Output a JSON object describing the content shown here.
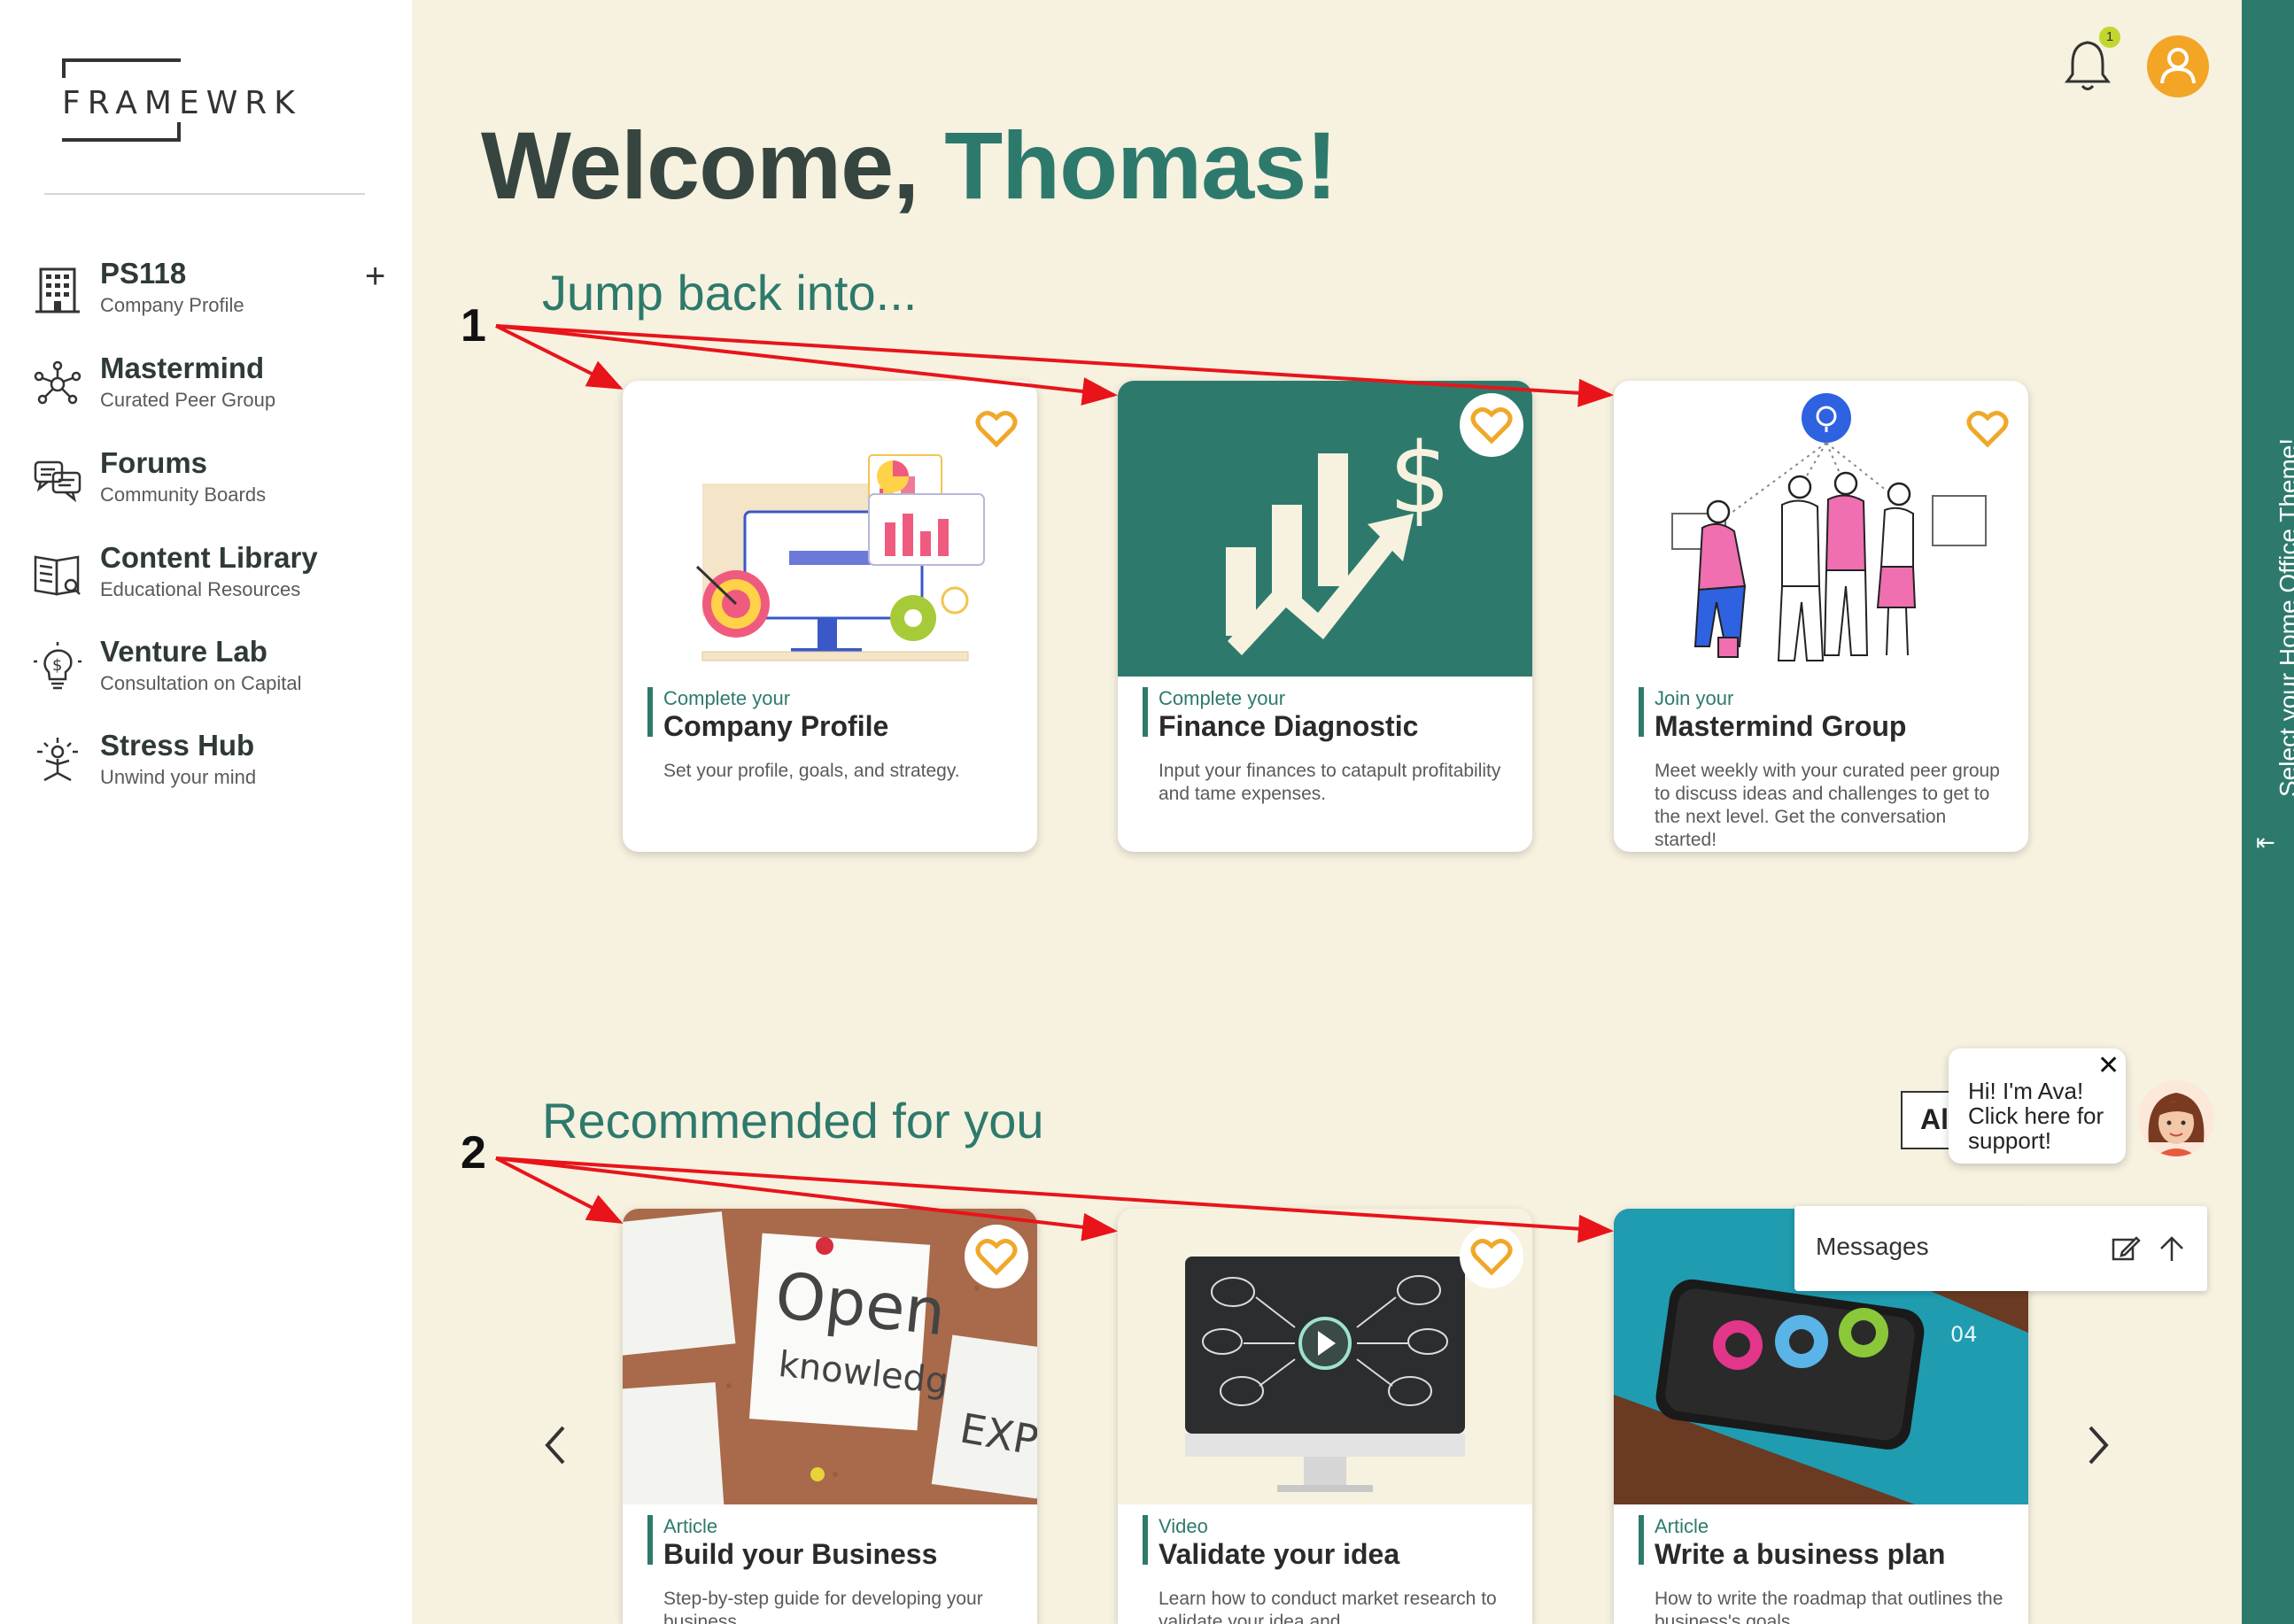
{
  "sidebar": {
    "logo": "FRAMEWRK",
    "items": [
      {
        "title": "PS118",
        "subtitle": "Company Profile",
        "icon": "building-icon",
        "action": "+"
      },
      {
        "title": "Mastermind",
        "subtitle": "Curated Peer Group",
        "icon": "network-icon"
      },
      {
        "title": "Forums",
        "subtitle": "Community Boards",
        "icon": "chat-bubbles-icon"
      },
      {
        "title": "Content Library",
        "subtitle": "Educational Resources",
        "icon": "book-icon"
      },
      {
        "title": "Venture Lab",
        "subtitle": "Consultation on Capital",
        "icon": "lightbulb-dollar-icon"
      },
      {
        "title": "Stress Hub",
        "subtitle": "Unwind your mind",
        "icon": "relax-person-icon"
      }
    ]
  },
  "header": {
    "notification_count": "1",
    "welcome_prefix": "Welcome, ",
    "welcome_name": "Thomas!"
  },
  "annotations": {
    "marker_1": "1",
    "marker_2": "2"
  },
  "jump_back": {
    "title": "Jump back into...",
    "cards": [
      {
        "kicker": "Complete your",
        "title": "Company Profile",
        "desc": "Set your profile, goals, and strategy."
      },
      {
        "kicker": "Complete your",
        "title": "Finance Diagnostic",
        "desc": "Input your finances to catapult profitability and tame expenses."
      },
      {
        "kicker": "Join your",
        "title": "Mastermind Group",
        "desc": "Meet weekly with your curated peer group to discuss ideas and challenges to get to the next level. Get the conversation started!"
      }
    ]
  },
  "recommended": {
    "title": "Recommended for you",
    "filter_label": "All",
    "cards": [
      {
        "kicker": "Article",
        "title": "Build your Business",
        "desc": "Step-by-step guide for developing your business"
      },
      {
        "kicker": "Video",
        "title": "Validate your idea",
        "desc": "Learn how to conduct market research to validate your idea and"
      },
      {
        "kicker": "Article",
        "title": "Write a business plan",
        "desc": "How to write the roadmap that outlines the business's goals"
      }
    ]
  },
  "theme_panel": {
    "label": "Select your Home Office Theme!",
    "toggle": "⇤"
  },
  "ava": {
    "text": "Hi! I'm Ava! Click here for support!",
    "close": "✕"
  },
  "messages": {
    "label": "Messages"
  },
  "colors": {
    "brand_green": "#2d7a6c",
    "background": "#f7f1e0",
    "heart": "#f0a82a",
    "avatar": "#f3a526"
  }
}
